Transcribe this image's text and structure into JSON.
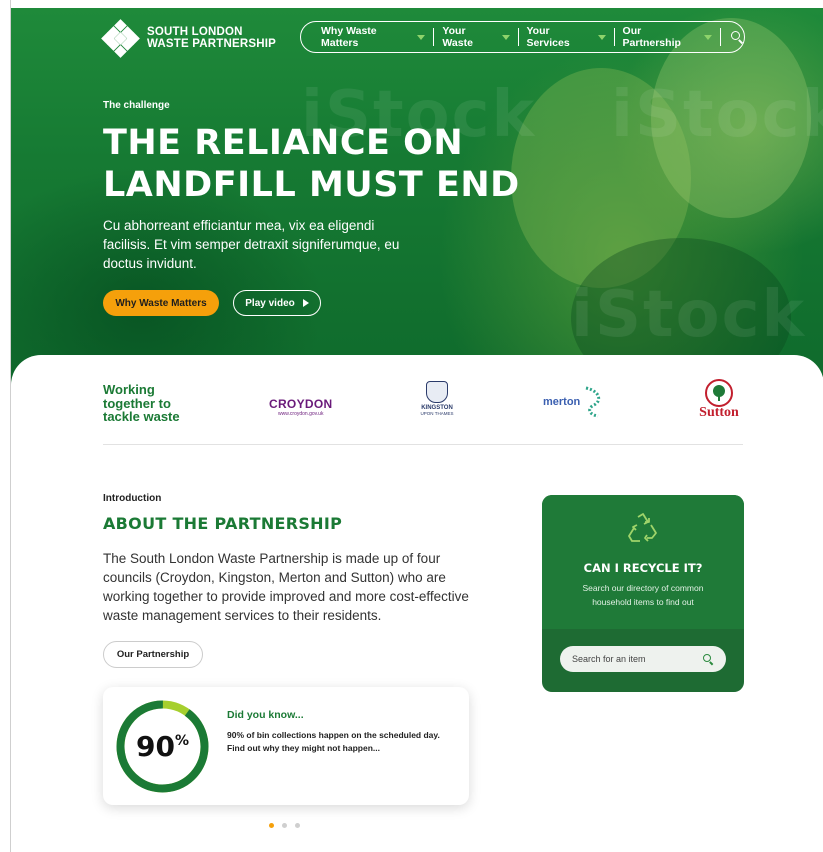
{
  "header": {
    "logo_line1": "SOUTH LONDON",
    "logo_line2": "WASTE PARTNERSHIP",
    "nav": [
      {
        "label": "Why Waste Matters"
      },
      {
        "label": "Your Waste"
      },
      {
        "label": "Your Services"
      },
      {
        "label": "Our Partnership"
      }
    ]
  },
  "hero": {
    "eyebrow": "The challenge",
    "title_line1": "THE RELIANCE ON",
    "title_line2": "LANDFILL MUST END",
    "copy": "Cu abhorreant efficiantur mea, vix ea eligendi facilisis. Et vim semper detraxit signiferumque, eu doctus invidunt.",
    "primary_button": "Why Waste Matters",
    "secondary_button": "Play video",
    "watermark": "iStock"
  },
  "partners": {
    "tagline_line1": "Working",
    "tagline_line2": "together to",
    "tagline_line3": "tackle waste",
    "croydon_name": "CROYDON",
    "croydon_url": "www.croydon.gov.uk",
    "kingston_name": "KINGSTON",
    "kingston_sub": "UPON THAMES",
    "merton_name": "merton",
    "sutton_name": "Sutton"
  },
  "intro": {
    "eyebrow": "Introduction",
    "title": "ABOUT THE PARTNERSHIP",
    "copy": "The South London Waste Partnership is made up of four councils (Croydon, Kingston, Merton and Sutton) who are working together to provide improved and more cost-effective waste management services to their residents.",
    "button": "Our Partnership"
  },
  "fact": {
    "percent_number": "90",
    "percent_symbol": "%",
    "percent_value": 0.9,
    "title": "Did you know...",
    "text": "90% of bin collections happen on the scheduled day. Find out why they might not happen..."
  },
  "carousel": {
    "count": 3,
    "active": 0
  },
  "recycle": {
    "title": "CAN I RECYCLE IT?",
    "subtitle": "Search our directory of common household items to find out",
    "search_placeholder": "Search for an item"
  },
  "colors": {
    "brand_green": "#1b7a35",
    "accent_orange": "#f5a00b",
    "nav_caret": "#8ed36b"
  }
}
